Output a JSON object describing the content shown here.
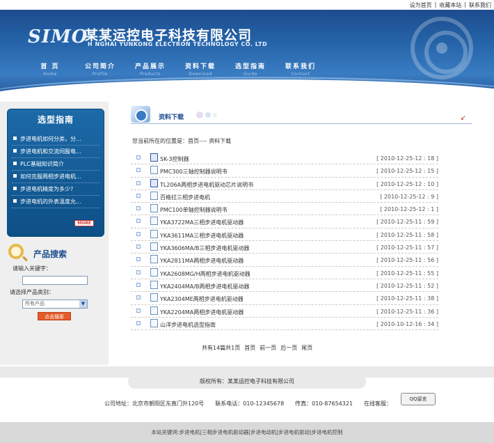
{
  "toplinks": [
    "设为首页",
    "收藏本站",
    "联系我们"
  ],
  "header": {
    "logo": "SIMO",
    "company_cn": "某某运控电子科技有限公司",
    "company_en": "H NGHAI YUNKONG ELECTRON TECHNOLOGY CO. LTD",
    "nav": [
      {
        "cn": "首 页",
        "en": "Home"
      },
      {
        "cn": "公司简介",
        "en": "Profile"
      },
      {
        "cn": "产品展示",
        "en": "Products"
      },
      {
        "cn": "资料下载",
        "en": "Download"
      },
      {
        "cn": "选型指南",
        "en": "Guide"
      },
      {
        "cn": "联系我们",
        "en": "Contact"
      }
    ]
  },
  "sidebar": {
    "guide_title": "选型指南",
    "guide_items": [
      "步进电机如何分类，分...",
      "步进电机和交流伺服电...",
      "PLC基础知识简介",
      "如何克服两相步进电机...",
      "步进电机精度为多少?",
      "步进电机的外表温度允..."
    ],
    "more_label": "MORE",
    "search_title": "产品搜索",
    "keyword_label": "请输入关键字：",
    "category_label": "请选择产品类别：",
    "category_value": "所有产品",
    "search_button": "点击搜索"
  },
  "main": {
    "page_title": "资料下载",
    "breadcrumb": "您当前所在的位置是：首页---- 资料下载",
    "files": [
      {
        "name": "SK-3控制器",
        "date": "[ 2010-12-25-12 : 18 ]",
        "type": "doc"
      },
      {
        "name": "PMC300三轴控制器说明书",
        "date": "[ 2010-12-25-12 : 15 ]",
        "type": "pdf"
      },
      {
        "name": "TL206A两相步进电机驱动芯片说明书",
        "date": "[ 2010-12-25-12 : 10 ]",
        "type": "doc"
      },
      {
        "name": "百格拉三相步进电机",
        "date": "[ 2010-12-25-12 : 9 ]",
        "type": "pdf"
      },
      {
        "name": "PMC100单轴控制器说明书",
        "date": "[ 2010-12-25-12 : 1 ]",
        "type": "pdf"
      },
      {
        "name": "YKA3722MA三相步进电机驱动器",
        "date": "[ 2010-12-25-11 : 59 ]",
        "type": "pdf"
      },
      {
        "name": "YKA3611MA三相步进电机驱动器",
        "date": "[ 2010-12-25-11 : 58 ]",
        "type": "pdf"
      },
      {
        "name": "YKA3606MA/B三相步进电机驱动器",
        "date": "[ 2010-12-25-11 : 57 ]",
        "type": "pdf"
      },
      {
        "name": "YKA2811MA两相步进电机驱动器",
        "date": "[ 2010-12-25-11 : 56 ]",
        "type": "pdf"
      },
      {
        "name": "YKA2608MG/H两相步进电机驱动器",
        "date": "[ 2010-12-25-11 : 55 ]",
        "type": "pdf"
      },
      {
        "name": "YKA2404MA/B两相步进电机驱动器",
        "date": "[ 2010-12-25-11 : 52 ]",
        "type": "pdf"
      },
      {
        "name": "YKA2304ME两相步进电机驱动器",
        "date": "[ 2010-12-25-11 : 38 ]",
        "type": "pdf"
      },
      {
        "name": "YKA2204MA两相步进电机驱动器",
        "date": "[ 2010-12-25-11 : 36 ]",
        "type": "pdf"
      },
      {
        "name": "山洋步进电机选型指南",
        "date": "[ 2010-10-12-16 : 34 ]",
        "type": "pdf"
      }
    ],
    "pager": {
      "summary": "共有14篇共1页",
      "first": "首页",
      "prev": "前一页",
      "next": "后一页",
      "last": "尾页"
    }
  },
  "footer": {
    "copyright": "版权所有：某某运控电子科技有限公司",
    "address": "公司地址：北京市朝阳区东直门外120号",
    "phone": "联系电话：010-12345678",
    "fax": "传真：010-87654321",
    "online": "在线客服：",
    "qq_label": "QQ留言",
    "keywords": "本站关键词:步进电机|三相步进电机驱动器|步进电动机|步进电机驱动|步进电机控制"
  }
}
